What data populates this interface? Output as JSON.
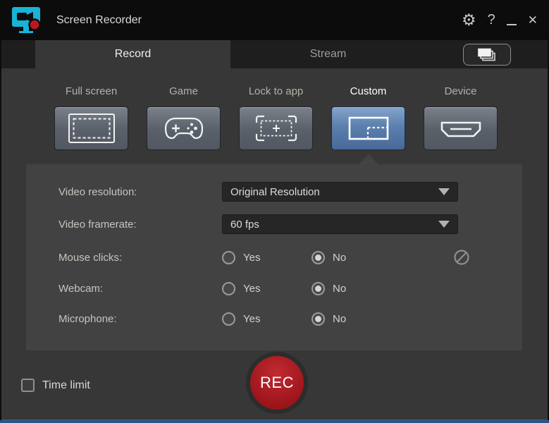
{
  "titlebar": {
    "title": "Screen Recorder",
    "gear_glyph": "⚙",
    "help_glyph": "?",
    "close_glyph": "✕"
  },
  "tabs": [
    {
      "label": "Record",
      "active": true
    },
    {
      "label": "Stream",
      "active": false
    }
  ],
  "compact_view_button": {
    "icon": "stacked-windows-icon"
  },
  "modes": [
    {
      "label": "Full screen",
      "icon": "fullscreen-region-icon",
      "selected": false
    },
    {
      "label": "Game",
      "icon": "gamepad-icon",
      "selected": false
    },
    {
      "label": "Lock to app",
      "icon": "lock-to-app-icon",
      "selected": false
    },
    {
      "label": "Custom",
      "icon": "custom-region-icon",
      "selected": true
    },
    {
      "label": "Device",
      "icon": "hdmi-device-icon",
      "selected": false
    }
  ],
  "settings": {
    "video_resolution": {
      "label": "Video resolution:",
      "value": "Original Resolution"
    },
    "video_framerate": {
      "label": "Video framerate:",
      "value": "60 fps"
    },
    "mouse_clicks": {
      "label": "Mouse clicks:",
      "yes": "Yes",
      "no": "No",
      "selected": "No",
      "extra_icon": "prohibited-icon"
    },
    "webcam": {
      "label": "Webcam:",
      "yes": "Yes",
      "no": "No",
      "selected": "No"
    },
    "microphone": {
      "label": "Microphone:",
      "yes": "Yes",
      "no": "No",
      "selected": "No"
    }
  },
  "footer": {
    "time_limit": {
      "label": "Time limit",
      "checked": false
    },
    "record_button": {
      "label": "REC"
    }
  },
  "colors": {
    "selected_mode_blue": "#5c80ad",
    "record_red": "#9a141a",
    "brand_cyan": "#17b3d8",
    "bottom_accent": "#28568a",
    "panel_bg": "#424242",
    "titlebar_bg": "#0c0c0c"
  }
}
